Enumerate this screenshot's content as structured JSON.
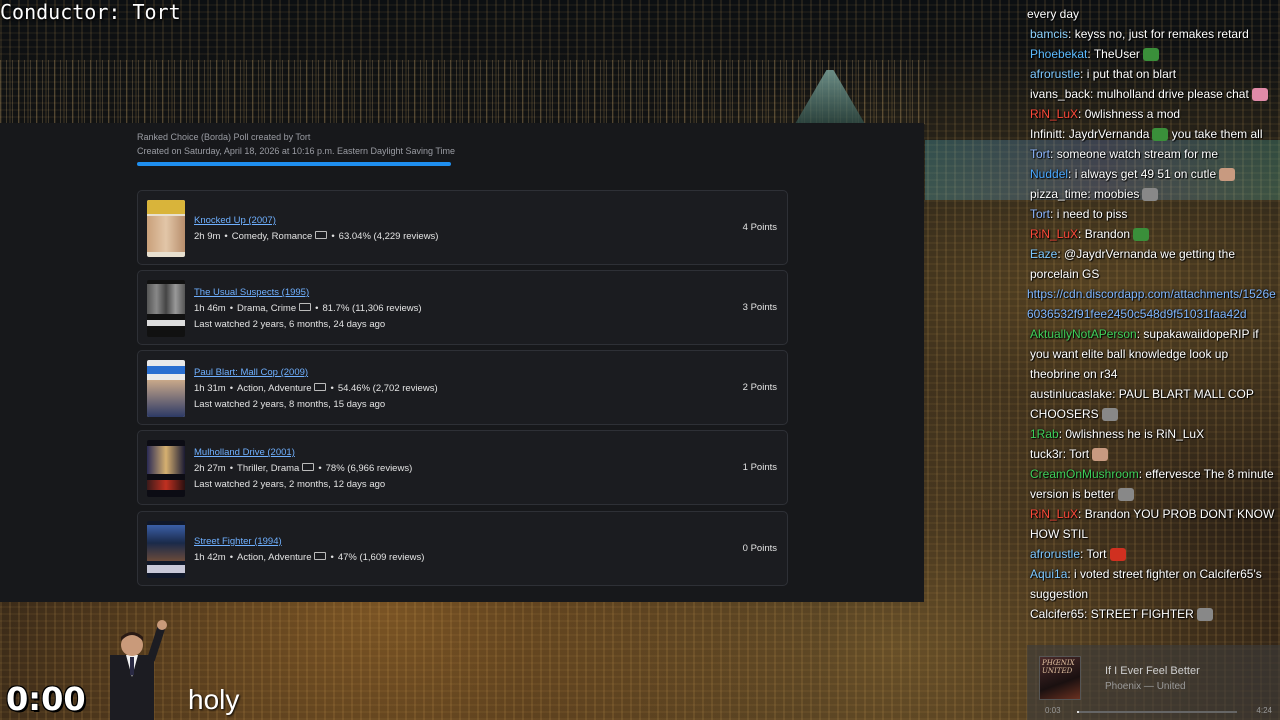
{
  "stream": {
    "conductor": "Conductor: Tort",
    "timer": "0:00",
    "caption": "holy"
  },
  "poll": {
    "created_by": "Ranked Choice (Borda) Poll created by Tort",
    "created_on": "Created on Saturday, April 18, 2026 at 10:16 p.m. Eastern Daylight Saving Time",
    "progress_color": "#1f8ff0",
    "entries": [
      {
        "title": "Knocked Up (2007)",
        "runtime": "2h 9m",
        "genres": "Comedy, Romance",
        "rating": "63.04% (4,229 reviews)",
        "last_watched": "",
        "points": "4 Points",
        "poster_icon": "knocked-up-poster"
      },
      {
        "title": "The Usual Suspects (1995)",
        "runtime": "1h 46m",
        "genres": "Drama, Crime",
        "rating": "81.7% (11,306 reviews)",
        "last_watched": "Last watched 2 years, 6 months, 24 days ago",
        "points": "3 Points",
        "poster_icon": "usual-suspects-poster"
      },
      {
        "title": "Paul Blart: Mall Cop (2009)",
        "runtime": "1h 31m",
        "genres": "Action, Adventure",
        "rating": "54.46% (2,702 reviews)",
        "last_watched": "Last watched 2 years, 8 months, 15 days ago",
        "points": "2 Points",
        "poster_icon": "paul-blart-poster"
      },
      {
        "title": "Mulholland Drive (2001)",
        "runtime": "2h 27m",
        "genres": "Thriller, Drama",
        "rating": "78% (6,966 reviews)",
        "last_watched": "Last watched 2 years, 2 months, 12 days ago",
        "points": "1 Points",
        "poster_icon": "mulholland-drive-poster"
      },
      {
        "title": "Street Fighter (1994)",
        "runtime": "1h 42m",
        "genres": "Action, Adventure",
        "rating": "47% (1,609 reviews)",
        "last_watched": "",
        "points": "0 Points",
        "poster_icon": "street-fighter-poster"
      }
    ]
  },
  "chat": {
    "messages": [
      {
        "user": "",
        "text": "every day",
        "color": "#ffffff"
      },
      {
        "user": "bamcis",
        "text": "keyss no, just for remakes retard",
        "color": "#8fd3ff"
      },
      {
        "user": "Phoebekat",
        "text": "TheUser",
        "color": "#5dbbff",
        "emote": "pepe-emote"
      },
      {
        "user": "afrorustle",
        "text": "i put that on blart",
        "color": "#7ec8ff"
      },
      {
        "user": "ivans_back",
        "text": "mulholland drive please chat",
        "color": "#ffffff",
        "emote": "pink-emote"
      },
      {
        "user": "RiN_LuX",
        "text": "0wlishness a mod",
        "color": "#ff4a3a"
      },
      {
        "user": "Infinitt",
        "text": "JaydrVernanda",
        "color": "#ffffff",
        "emote": "pepe-emote",
        "after": "you take them all"
      },
      {
        "user": "Tort",
        "text": "someone watch stream for me",
        "color": "#8fb8ff"
      },
      {
        "user": "Nuddel",
        "text": "i always get 49 51 on cutle",
        "color": "#4aa8ff",
        "emote": "face-emote"
      },
      {
        "user": "pizza_time",
        "text": "moobies",
        "color": "#ffffff",
        "emote": "gray-emote"
      },
      {
        "user": "Tort",
        "text": "i need to piss",
        "color": "#8fb8ff"
      },
      {
        "user": "RiN_LuX",
        "text": "Brandon",
        "color": "#ff4a3a",
        "emote": "pepe-emote"
      },
      {
        "user": "Eaze",
        "text": "@JaydrVernanda we getting the porcelain GS",
        "color": "#7ec8ff"
      },
      {
        "user": "",
        "text": "https://cdn.discordapp.com/attachments/1526e6036532f91fee2450c548d9f51031faa42d",
        "color": "#7fb6ff",
        "link": true
      },
      {
        "user": "AktuallyNotAPerson",
        "text": "supakawaiidopeRIP if you want elite ball knowledge look up theobrine on r34",
        "color": "#3fcf5a"
      },
      {
        "user": "austinlucaslake",
        "text": "PAUL BLART MALL COP CHOOSERS",
        "color": "#ffffff",
        "emote": "gray-emote"
      },
      {
        "user": "1Rab",
        "text": "0wlishness he is RiN_LuX",
        "color": "#3fcf5a"
      },
      {
        "user": "tuck3r",
        "text": "Tort",
        "color": "#ffffff",
        "emote": "face-emote"
      },
      {
        "user": "CreamOnMushroom",
        "text": "effervesce The 8 minute version is better",
        "color": "#3fcf5a",
        "emote": "gray-emote"
      },
      {
        "user": "RiN_LuX",
        "text": "Brandon YOU PROB DONT KNOW HOW STIL",
        "color": "#ff4a3a"
      },
      {
        "user": "afrorustle",
        "text": "Tort",
        "color": "#7ec8ff",
        "emote": "red-emote"
      },
      {
        "user": "Aqui1a",
        "text": "i voted street fighter on Calcifer65's suggestion",
        "color": "#7ec8ff"
      },
      {
        "user": "Calcifer65",
        "text": "STREET FIGHTER",
        "color": "#ffffff",
        "emote": "gray-emote"
      }
    ]
  },
  "now_playing": {
    "song": "If I Ever Feel Better",
    "artist": "Phoenix — United",
    "album_art_text": "PHŒNIX UNITED",
    "elapsed": "0:03",
    "duration": "4:24",
    "progress": 0.01
  }
}
